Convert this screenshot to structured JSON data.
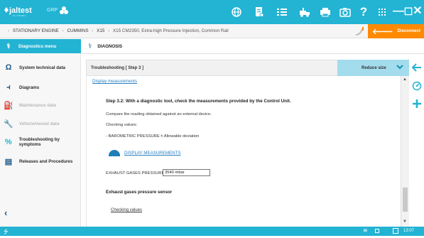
{
  "app": {
    "logo_text": "jaltest",
    "logo_sub": "by COJALI",
    "group_label": "GRP"
  },
  "colors": {
    "brand": "#23b3d3",
    "accent_orange": "#ff8a00",
    "reduce_bg": "#a2dced",
    "link": "#2a7fc0"
  },
  "toolbar": {
    "icons": [
      "globe-icon",
      "document-icon",
      "list-icon",
      "truck-icon",
      "printer-icon",
      "camera-icon",
      "help-icon",
      "apps-icon",
      "minimize-icon",
      "maximize-icon",
      "close-icon"
    ],
    "help": "?",
    "minimize": "—",
    "maximize": "☐",
    "close": "✕"
  },
  "breadcrumb": {
    "items": [
      "STATIONARY ENGINE",
      "CUMMINS",
      "X15",
      "X15 CM2350, Extra-high Pressure Injection, Common Rail"
    ]
  },
  "disconnect": {
    "label": "Disconnect"
  },
  "sidebar": {
    "header": "Diagnostics menu",
    "items": [
      {
        "label": "System technical data",
        "icon": "omega-icon",
        "enabled": true
      },
      {
        "label": "Diagrams",
        "icon": "diagram-icon",
        "enabled": true
      },
      {
        "label": "Maintenance data",
        "icon": "oil-can-icon",
        "enabled": false
      },
      {
        "label": "Vehicle/vessel data",
        "icon": "wrench-icon",
        "enabled": false
      },
      {
        "label": "Troubleshooting by symptoms",
        "icon": "percent-icon",
        "enabled": true
      },
      {
        "label": "Releases and Procedures",
        "icon": "book-icon",
        "enabled": true
      }
    ],
    "back": "‹"
  },
  "main": {
    "title": "DIAGNOSIS",
    "step_title": "Troubleshooting [ Step 3 ]",
    "reduce_label": "Reduce size"
  },
  "doc": {
    "link_top": "Display measurements",
    "step_heading": "Step 3.2: With a diagnostic tool, check the measurements provided by the Control Unit.",
    "compare": "Compare the reading obtained against an external device.",
    "checking_values": "Checking values:",
    "barometric": "- BAROMETRIC PRESSURE ± Allowable deviation",
    "display_measurements": "DISPLAY MEASUREMENTS",
    "exhaust_label": "EXHAUST GASES PRESSURE",
    "exhaust_value": "3540 mbar",
    "sensor_heading": "Exhaust gases pressure sensor",
    "checking_values_link": "Checking values"
  },
  "right_actions": [
    "back-arrow-icon",
    "gauge-icon",
    "plus-icon"
  ],
  "status": {
    "time": "13:07"
  }
}
